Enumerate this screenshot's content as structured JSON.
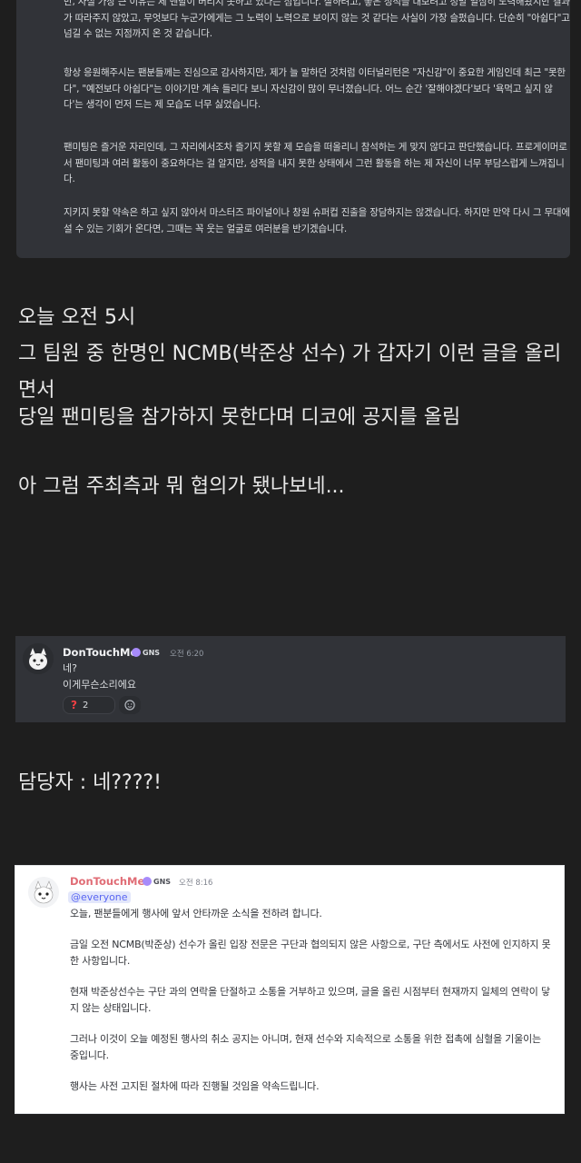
{
  "top_card": {
    "para1": "만, 사실 가장 큰 이유는 제 멘탈이 버티지 못하고 있다는 점입니다. 잘하려고, 좋은 성적을 내보려고 정말 열심히 노력해왔지만 결과가 따라주지 않았고, 무엇보다 누군가에게는 그 노력이 노력으로 보이지 않는 것 같다는 사실이 가장 슬펐습니다. 단순히 \"아쉽다\"고 넘길 수 없는 지점까지 온 것 같습니다.",
    "para2": "항상 응원해주시는 팬분들께는 진심으로 감사하지만, 제가 늘 말하던 것처럼 이터널리턴은 \"자신감\"이 중요한 게임인데 최근 \"못한다\", \"예전보다 아쉽다\"는 이야기만 계속 들리다 보니 자신감이 많이 무너졌습니다. 어느 순간 '잘해야겠다'보다 '욕먹고 싶지 않다'는 생각이 먼저 드는 제 모습도 너무 싫었습니다.",
    "para3": "팬미팅은 즐거운 자리인데, 그 자리에서조차 즐기지 못할 제 모습을 떠올리니 참석하는 게 맞지 않다고 판단했습니다. 프로게이머로서 팬미팅과 여러 활동이 중요하다는 걸 알지만, 성적을 내지 못한 상태에서 그런 활동을 하는 제 자신이 너무 부담스럽게 느껴집니다.",
    "para4": "지키지 못할 약속은 하고 싶지 않아서 마스터즈 파이널이나 창원 슈퍼컵 진출을 장담하지는 않겠습니다. 하지만 만약 다시 그 무대에 설 수 있는 기회가 온다면, 그때는 꼭 웃는 얼굴로 여러분을 반기겠습니다."
  },
  "post": {
    "line1": "오늘 오전 5시",
    "line2": "그 팀원 중 한명인 NCMB(박준상 선수) 가 갑자기 이런 글을 올리면서",
    "line3": "당일 팬미팅을 참가하지 못한다며 디코에 공지를 올림",
    "line4": "아 그럼 주최측과 뭐 협의가 됐나보네...",
    "line5": "담당자 : 네????!"
  },
  "dm_card": {
    "username": "DonTouchMe",
    "tag": "GNS",
    "time": "오전 6:20",
    "line1": "네?",
    "line2": "이게무슨소리에요",
    "reaction_count": "2"
  },
  "announcement": {
    "username": "DonTouchMe",
    "tag": "GNS",
    "time": "오전 8:16",
    "mention": "@everyone",
    "p1": "오늘, 팬분들에게 행사에 앞서 안타까운 소식을 전하려 합니다.",
    "p2": "금일 오전 NCMB(박준상) 선수가 올린 입장 전문은 구단과 협의되지 않은 사항으로, 구단 측에서도 사전에 인지하지 못한 사항입니다.",
    "p3": "현재 박준상선수는 구단 과의 연락을 단절하고 소통을 거부하고 있으며, 글을 올린 시점부터 현재까지 일체의 연락이 닿지 않는 상태입니다.",
    "p4": "그러나 이것이 오늘 예정된 행사의 취소 공지는 아니며, 현재 선수와 지속적으로 소통을 위한 접촉에 심혈을 기울이는 중입니다.",
    "p5": "행사는 사전 고지된 절차에 따라 진행될 것임을 약속드립니다."
  },
  "colors": {
    "page_bg": "#1e1e1e",
    "discord_dark": "#313338",
    "username_pink": "#e06c75",
    "mention_blue": "#5865f2"
  },
  "icons": {
    "avatar": "cat-avatar-icon",
    "tag": "gns-tag-icon",
    "reaction": "question-mark-icon",
    "add_reaction": "add-reaction-icon"
  }
}
